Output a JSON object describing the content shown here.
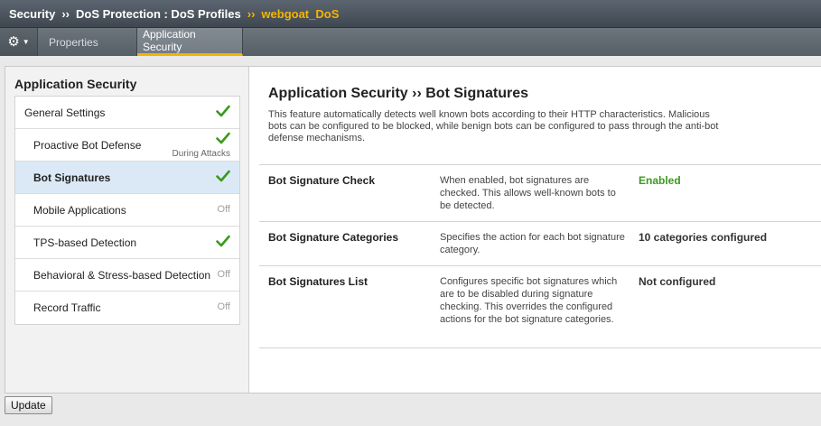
{
  "breadcrumb": {
    "items": [
      "Security",
      "DoS Protection : DoS Profiles"
    ],
    "separator": "››",
    "active": "webgoat_DoS"
  },
  "tabs": {
    "gear_icon": "gear-icon",
    "items": [
      {
        "label": "Properties",
        "active": false
      },
      {
        "label": "Application Security",
        "active": true
      }
    ]
  },
  "sidebar": {
    "title": "Application Security",
    "items": [
      {
        "label": "General Settings",
        "status": "check",
        "status_text": ""
      },
      {
        "label": "Proactive Bot Defense",
        "status": "check",
        "status_text": "During Attacks"
      },
      {
        "label": "Bot Signatures",
        "status": "check",
        "status_text": ""
      },
      {
        "label": "Mobile Applications",
        "status": "off",
        "status_text": "Off"
      },
      {
        "label": "TPS-based Detection",
        "status": "check",
        "status_text": ""
      },
      {
        "label": "Behavioral & Stress-based Detection",
        "status": "off",
        "status_text": "Off"
      },
      {
        "label": "Record Traffic",
        "status": "off",
        "status_text": "Off"
      }
    ]
  },
  "main": {
    "title": "Application Security ›› Bot Signatures",
    "description": "This feature automatically detects well known bots according to their HTTP characteristics. Malicious bots can be configured to be blocked, while benign bots can be configured to pass through the anti-bot defense mechanisms.",
    "rows": [
      {
        "label": "Bot Signature Check",
        "description": "When enabled, bot signatures are checked. This allows well-known bots to be detected.",
        "value": "Enabled"
      },
      {
        "label": "Bot Signature Categories",
        "description": "Specifies the action for each bot signature category.",
        "value": "10 categories configured"
      },
      {
        "label": "Bot Signatures List",
        "description": "Configures specific bot signatures which are to be disabled during signature checking. This overrides the configured actions for the bot signature categories.",
        "value": "Not configured"
      }
    ]
  },
  "footer": {
    "update_label": "Update"
  },
  "colors": {
    "accent": "#f5b400",
    "check_green": "#3a9a1e",
    "selected_bg": "#dbe9f6"
  }
}
